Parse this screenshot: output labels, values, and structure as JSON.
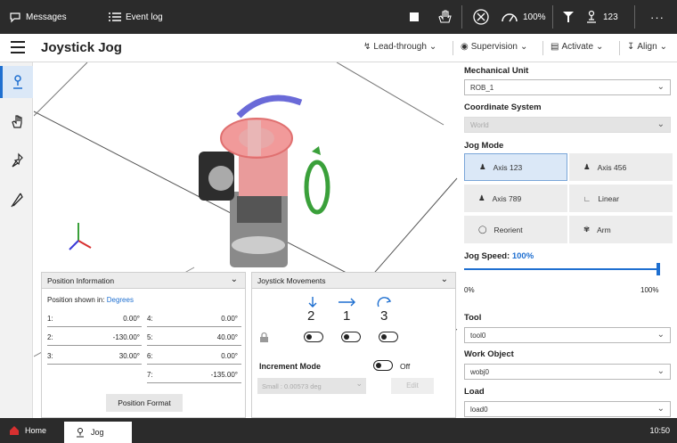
{
  "topbar": {
    "messages": "Messages",
    "event_log": "Event log",
    "speed": "100%",
    "mech": "123"
  },
  "header": {
    "title": "Joystick Jog",
    "lead_through": "Lead-through",
    "supervision": "Supervision",
    "activate": "Activate",
    "align": "Align"
  },
  "position_info": {
    "title": "Position Information",
    "shown_in_label": "Position shown in:",
    "shown_in_value": "Degrees",
    "rows": [
      {
        "l1": "1:",
        "v1": "0.00°",
        "l2": "4:",
        "v2": "0.00°"
      },
      {
        "l1": "2:",
        "v1": "-130.00°",
        "l2": "5:",
        "v2": "40.00°"
      },
      {
        "l1": "3:",
        "v1": "30.00°",
        "l2": "6:",
        "v2": "0.00°"
      },
      {
        "l1": "",
        "v1": "",
        "l2": "7:",
        "v2": "-135.00°"
      }
    ],
    "format_button": "Position Format"
  },
  "joystick": {
    "title": "Joystick Movements",
    "dir1": "2",
    "dir2": "1",
    "dir3": "3",
    "increment_label": "Increment Mode",
    "increment_state": "Off",
    "increment_select": "Small : 0.00573 deg",
    "edit_button": "Edit"
  },
  "right": {
    "mech_label": "Mechanical Unit",
    "mech_value": "ROB_1",
    "coord_label": "Coordinate System",
    "coord_value": "World",
    "jogmode_label": "Jog Mode",
    "modes": [
      "Axis 123",
      "Axis 456",
      "Axis 789",
      "Linear",
      "Reorient",
      "Arm"
    ],
    "speed_label": "Jog Speed:",
    "speed_value": "100%",
    "speed_min": "0%",
    "speed_max": "100%",
    "speed_level": 1.0,
    "tool_label": "Tool",
    "tool_value": "tool0",
    "wobj_label": "Work Object",
    "wobj_value": "wobj0",
    "load_label": "Load",
    "load_value": "load0"
  },
  "bottom": {
    "home": "Home",
    "jog": "Jog",
    "time": "10:50"
  }
}
